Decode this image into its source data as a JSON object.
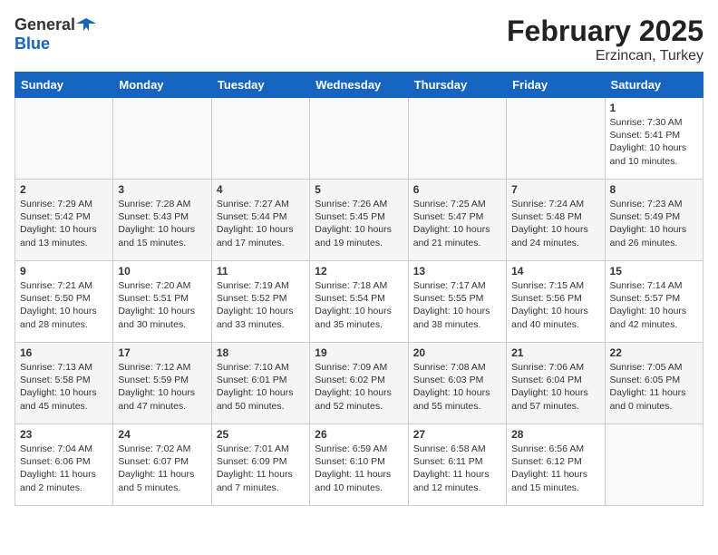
{
  "header": {
    "logo_general": "General",
    "logo_blue": "Blue",
    "month_year": "February 2025",
    "location": "Erzincan, Turkey"
  },
  "weekdays": [
    "Sunday",
    "Monday",
    "Tuesday",
    "Wednesday",
    "Thursday",
    "Friday",
    "Saturday"
  ],
  "weeks": [
    [
      {
        "day": "",
        "info": ""
      },
      {
        "day": "",
        "info": ""
      },
      {
        "day": "",
        "info": ""
      },
      {
        "day": "",
        "info": ""
      },
      {
        "day": "",
        "info": ""
      },
      {
        "day": "",
        "info": ""
      },
      {
        "day": "1",
        "info": "Sunrise: 7:30 AM\nSunset: 5:41 PM\nDaylight: 10 hours\nand 10 minutes."
      }
    ],
    [
      {
        "day": "2",
        "info": "Sunrise: 7:29 AM\nSunset: 5:42 PM\nDaylight: 10 hours\nand 13 minutes."
      },
      {
        "day": "3",
        "info": "Sunrise: 7:28 AM\nSunset: 5:43 PM\nDaylight: 10 hours\nand 15 minutes."
      },
      {
        "day": "4",
        "info": "Sunrise: 7:27 AM\nSunset: 5:44 PM\nDaylight: 10 hours\nand 17 minutes."
      },
      {
        "day": "5",
        "info": "Sunrise: 7:26 AM\nSunset: 5:45 PM\nDaylight: 10 hours\nand 19 minutes."
      },
      {
        "day": "6",
        "info": "Sunrise: 7:25 AM\nSunset: 5:47 PM\nDaylight: 10 hours\nand 21 minutes."
      },
      {
        "day": "7",
        "info": "Sunrise: 7:24 AM\nSunset: 5:48 PM\nDaylight: 10 hours\nand 24 minutes."
      },
      {
        "day": "8",
        "info": "Sunrise: 7:23 AM\nSunset: 5:49 PM\nDaylight: 10 hours\nand 26 minutes."
      }
    ],
    [
      {
        "day": "9",
        "info": "Sunrise: 7:21 AM\nSunset: 5:50 PM\nDaylight: 10 hours\nand 28 minutes."
      },
      {
        "day": "10",
        "info": "Sunrise: 7:20 AM\nSunset: 5:51 PM\nDaylight: 10 hours\nand 30 minutes."
      },
      {
        "day": "11",
        "info": "Sunrise: 7:19 AM\nSunset: 5:52 PM\nDaylight: 10 hours\nand 33 minutes."
      },
      {
        "day": "12",
        "info": "Sunrise: 7:18 AM\nSunset: 5:54 PM\nDaylight: 10 hours\nand 35 minutes."
      },
      {
        "day": "13",
        "info": "Sunrise: 7:17 AM\nSunset: 5:55 PM\nDaylight: 10 hours\nand 38 minutes."
      },
      {
        "day": "14",
        "info": "Sunrise: 7:15 AM\nSunset: 5:56 PM\nDaylight: 10 hours\nand 40 minutes."
      },
      {
        "day": "15",
        "info": "Sunrise: 7:14 AM\nSunset: 5:57 PM\nDaylight: 10 hours\nand 42 minutes."
      }
    ],
    [
      {
        "day": "16",
        "info": "Sunrise: 7:13 AM\nSunset: 5:58 PM\nDaylight: 10 hours\nand 45 minutes."
      },
      {
        "day": "17",
        "info": "Sunrise: 7:12 AM\nSunset: 5:59 PM\nDaylight: 10 hours\nand 47 minutes."
      },
      {
        "day": "18",
        "info": "Sunrise: 7:10 AM\nSunset: 6:01 PM\nDaylight: 10 hours\nand 50 minutes."
      },
      {
        "day": "19",
        "info": "Sunrise: 7:09 AM\nSunset: 6:02 PM\nDaylight: 10 hours\nand 52 minutes."
      },
      {
        "day": "20",
        "info": "Sunrise: 7:08 AM\nSunset: 6:03 PM\nDaylight: 10 hours\nand 55 minutes."
      },
      {
        "day": "21",
        "info": "Sunrise: 7:06 AM\nSunset: 6:04 PM\nDaylight: 10 hours\nand 57 minutes."
      },
      {
        "day": "22",
        "info": "Sunrise: 7:05 AM\nSunset: 6:05 PM\nDaylight: 11 hours\nand 0 minutes."
      }
    ],
    [
      {
        "day": "23",
        "info": "Sunrise: 7:04 AM\nSunset: 6:06 PM\nDaylight: 11 hours\nand 2 minutes."
      },
      {
        "day": "24",
        "info": "Sunrise: 7:02 AM\nSunset: 6:07 PM\nDaylight: 11 hours\nand 5 minutes."
      },
      {
        "day": "25",
        "info": "Sunrise: 7:01 AM\nSunset: 6:09 PM\nDaylight: 11 hours\nand 7 minutes."
      },
      {
        "day": "26",
        "info": "Sunrise: 6:59 AM\nSunset: 6:10 PM\nDaylight: 11 hours\nand 10 minutes."
      },
      {
        "day": "27",
        "info": "Sunrise: 6:58 AM\nSunset: 6:11 PM\nDaylight: 11 hours\nand 12 minutes."
      },
      {
        "day": "28",
        "info": "Sunrise: 6:56 AM\nSunset: 6:12 PM\nDaylight: 11 hours\nand 15 minutes."
      },
      {
        "day": "",
        "info": ""
      }
    ]
  ]
}
